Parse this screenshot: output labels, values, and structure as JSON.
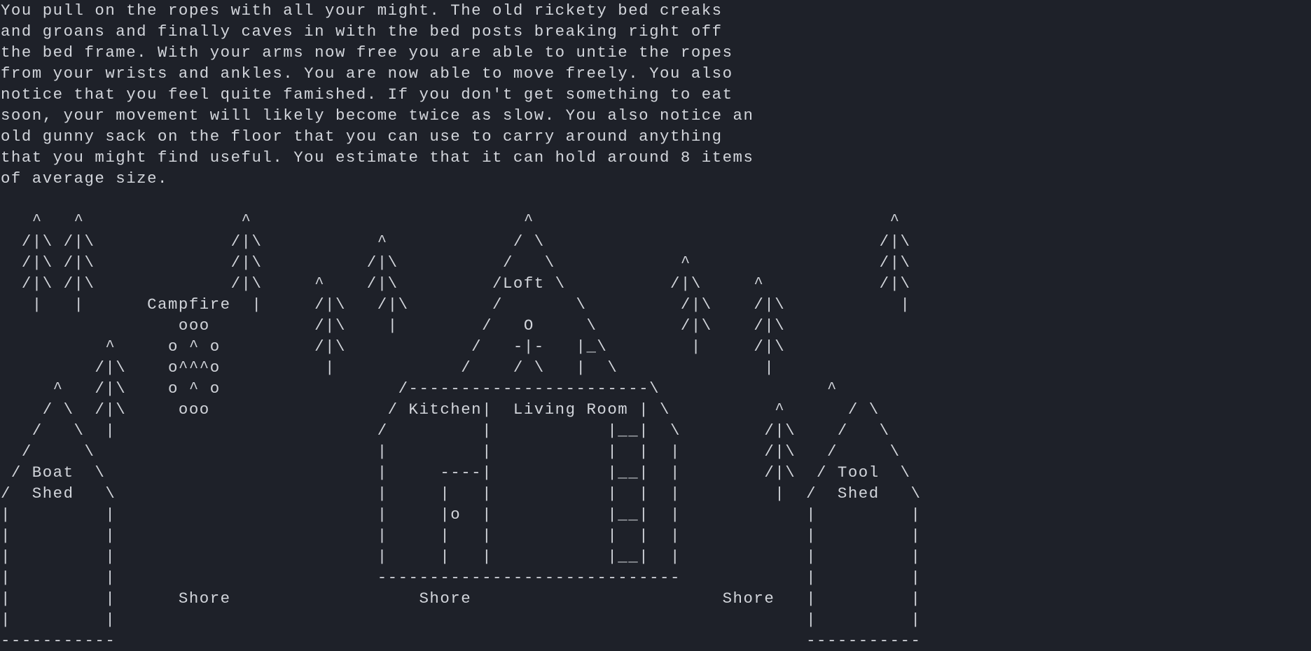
{
  "narrative": {
    "lines": [
      "You pull on the ropes with all your might. The old rickety bed creaks",
      "and groans and finally caves in with the bed posts breaking right off",
      "the bed frame. With your arms now free you are able to untie the ropes",
      "from your wrists and ankles. You are now able to move freely. You also",
      "notice that you feel quite famished. If you don't get something to eat",
      "soon, your movement will likely become twice as slow. You also notice an",
      "old gunny sack on the floor that you can use to carry around anything",
      "that you might find useful. You estimate that it can hold around 8 items",
      "of average size."
    ]
  },
  "map": {
    "lines": [
      "   ^   ^               ^                          ^                                  ^",
      "  /|\\ /|\\             /|\\           ^            / \\                                /|\\",
      "  /|\\ /|\\             /|\\          /|\\          /   \\            ^                  /|\\",
      "  /|\\ /|\\             /|\\     ^    /|\\         /Loft \\          /|\\     ^           /|\\",
      "   |   |      Campfire  |     /|\\   /|\\        /       \\         /|\\    /|\\           |",
      "                 ooo          /|\\    |        /   O     \\        /|\\    /|\\",
      "          ^     o ^ o         /|\\            /   -|-   |_\\        |     /|\\",
      "         /|\\    o^^^o          |            /    / \\   |  \\              |",
      "     ^   /|\\    o ^ o                 /-----------------------\\                ^",
      "    / \\  /|\\     ooo                 / Kitchen|  Living Room | \\          ^      / \\",
      "   /   \\  |                         /         |           |__|  \\        /|\\    /   \\",
      "  /     \\                           |         |           |  |  |        /|\\   /     \\",
      " / Boat  \\                          |     ----|           |__|  |        /|\\  / Tool  \\",
      "/  Shed   \\                         |     |   |           |  |  |         |  /  Shed   \\",
      "|         |                         |     |o  |           |__|  |            |         |",
      "|         |                         |     |   |           |  |  |            |         |",
      "|         |                         |     |   |           |__|  |            |         |",
      "|         |                         -----------------------------            |         |",
      "|         |      Shore                  Shore                        Shore   |         |",
      "|         |                                                                  |         |",
      "-----------                                                                  -----------"
    ]
  }
}
